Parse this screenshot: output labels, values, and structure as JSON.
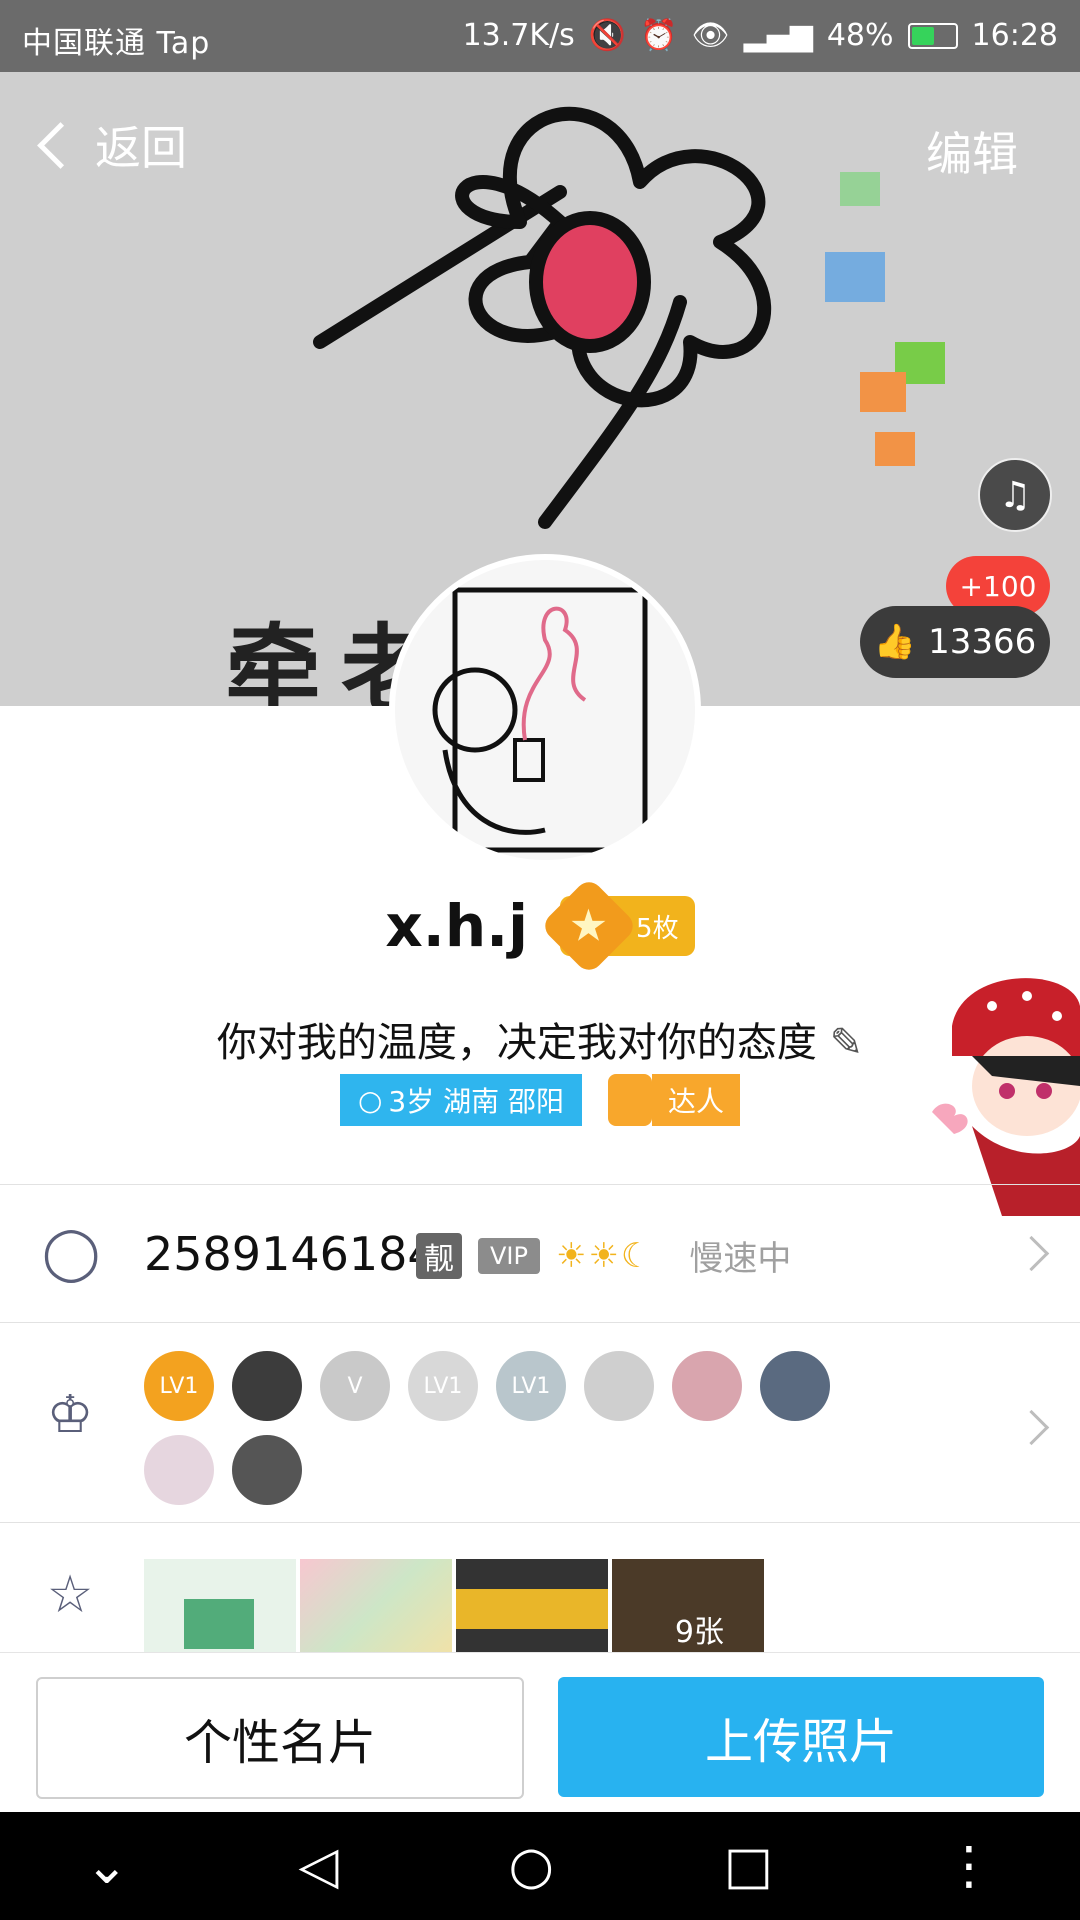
{
  "status_bar": {
    "carrier": "中国联通 Tap",
    "speed": "13.7K/s",
    "battery": "48%",
    "time": "16:28"
  },
  "header": {
    "back_label": "返回",
    "edit_label": "编辑",
    "cover_caption": "牵老手",
    "like_increment": "+100",
    "like_count": "13366"
  },
  "profile": {
    "name": "x.h.j",
    "medal_count": "5枚",
    "signature": "你对我的温度，决定我对你的态度",
    "location_tag": "3岁 湖南 邵阳",
    "daren_tag": "达人"
  },
  "qq_row": {
    "number": "2589146184",
    "liang_badge": "靓",
    "vip_badge": "VIP",
    "level_icons": "☀☀☾",
    "speed_status": "慢速中"
  },
  "badges_row": {
    "icons": [
      {
        "label": "LV1",
        "color": "#f3a21f"
      },
      {
        "label": "",
        "color": "#3c3c3c"
      },
      {
        "label": "V",
        "color": "#c9c9c9"
      },
      {
        "label": "LV1",
        "color": "#d8d8d8"
      },
      {
        "label": "LV1",
        "color": "#b9c6cc"
      },
      {
        "label": "",
        "color": "#cfcfcf"
      },
      {
        "label": "",
        "color": "#d9a5ae"
      },
      {
        "label": "",
        "color": "#5a6a80"
      },
      {
        "label": "",
        "color": "#e6d6df"
      },
      {
        "label": "",
        "color": "#555555"
      }
    ]
  },
  "photos_row": {
    "count_label": "9张"
  },
  "bottom": {
    "card_label": "个性名片",
    "upload_label": "上传照片"
  },
  "colors": {
    "accent": "#28b2f0",
    "like_badge": "#f4423a"
  }
}
